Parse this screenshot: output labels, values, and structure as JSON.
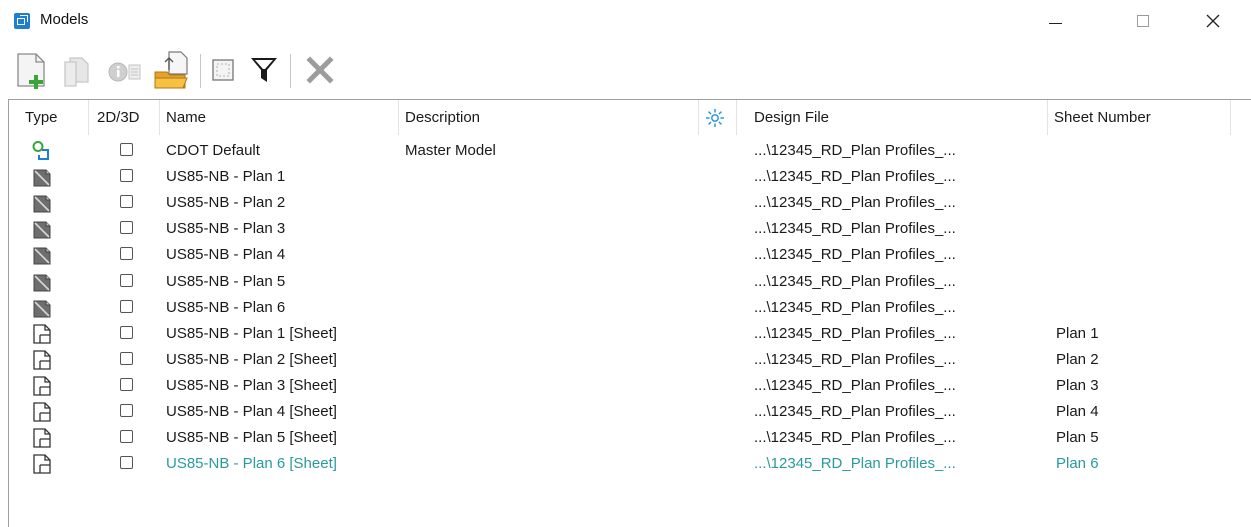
{
  "window": {
    "title": "Models",
    "app_icon": "models-window-icon",
    "controls": [
      "minimize-icon",
      "maximize-icon",
      "close-icon"
    ]
  },
  "toolbar": {
    "buttons": [
      {
        "name": "create-model",
        "icon": "new-model-icon",
        "enabled": true
      },
      {
        "name": "copy-model",
        "icon": "copy-model-icon",
        "enabled": false
      },
      {
        "name": "model-properties",
        "icon": "properties-icon",
        "enabled": false
      },
      {
        "name": "import-model",
        "icon": "import-model-icon",
        "enabled": true
      },
      {
        "name": "select-all",
        "icon": "select-all-icon",
        "enabled": true
      },
      {
        "name": "filter",
        "icon": "filter-icon",
        "enabled": true
      },
      {
        "name": "delete-model",
        "icon": "delete-icon",
        "enabled": false
      }
    ]
  },
  "columns": {
    "type": "Type",
    "dims": "2D/3D",
    "name": "Name",
    "description": "Description",
    "design_file": "Design File",
    "sheet_number": "Sheet Number",
    "active_icon": "sun-icon"
  },
  "rows": [
    {
      "type": "master-model-icon",
      "name": "CDOT Default",
      "description": "Master Model",
      "file": "...\\12345_RD_Plan Profiles_...",
      "sheet": "",
      "selected": false
    },
    {
      "type": "drawing-model-icon",
      "name": "US85-NB - Plan 1",
      "description": "",
      "file": "...\\12345_RD_Plan Profiles_...",
      "sheet": "",
      "selected": false
    },
    {
      "type": "drawing-model-icon",
      "name": "US85-NB - Plan 2",
      "description": "",
      "file": "...\\12345_RD_Plan Profiles_...",
      "sheet": "",
      "selected": false
    },
    {
      "type": "drawing-model-icon",
      "name": "US85-NB - Plan 3",
      "description": "",
      "file": "...\\12345_RD_Plan Profiles_...",
      "sheet": "",
      "selected": false
    },
    {
      "type": "drawing-model-icon",
      "name": "US85-NB - Plan 4",
      "description": "",
      "file": "...\\12345_RD_Plan Profiles_...",
      "sheet": "",
      "selected": false
    },
    {
      "type": "drawing-model-icon",
      "name": "US85-NB - Plan 5",
      "description": "",
      "file": "...\\12345_RD_Plan Profiles_...",
      "sheet": "",
      "selected": false
    },
    {
      "type": "drawing-model-icon",
      "name": "US85-NB - Plan 6",
      "description": "",
      "file": "...\\12345_RD_Plan Profiles_...",
      "sheet": "",
      "selected": false
    },
    {
      "type": "sheet-model-icon",
      "name": "US85-NB - Plan 1 [Sheet]",
      "description": "",
      "file": "...\\12345_RD_Plan Profiles_...",
      "sheet": "Plan 1",
      "selected": false
    },
    {
      "type": "sheet-model-icon",
      "name": "US85-NB - Plan 2 [Sheet]",
      "description": "",
      "file": "...\\12345_RD_Plan Profiles_...",
      "sheet": "Plan 2",
      "selected": false
    },
    {
      "type": "sheet-model-icon",
      "name": "US85-NB - Plan 3 [Sheet]",
      "description": "",
      "file": "...\\12345_RD_Plan Profiles_...",
      "sheet": "Plan 3",
      "selected": false
    },
    {
      "type": "sheet-model-icon",
      "name": "US85-NB - Plan 4 [Sheet]",
      "description": "",
      "file": "...\\12345_RD_Plan Profiles_...",
      "sheet": "Plan 4",
      "selected": false
    },
    {
      "type": "sheet-model-icon",
      "name": "US85-NB - Plan 5 [Sheet]",
      "description": "",
      "file": "...\\12345_RD_Plan Profiles_...",
      "sheet": "Plan 5",
      "selected": false
    },
    {
      "type": "sheet-model-icon",
      "name": "US85-NB - Plan 6 [Sheet]",
      "description": "",
      "file": "...\\12345_RD_Plan Profiles_...",
      "sheet": "Plan 6",
      "selected": true
    }
  ],
  "colors": {
    "selected_text": "#2a9a9a",
    "accent_green": "#3aa63a",
    "accent_blue": "#1e7fd0"
  }
}
